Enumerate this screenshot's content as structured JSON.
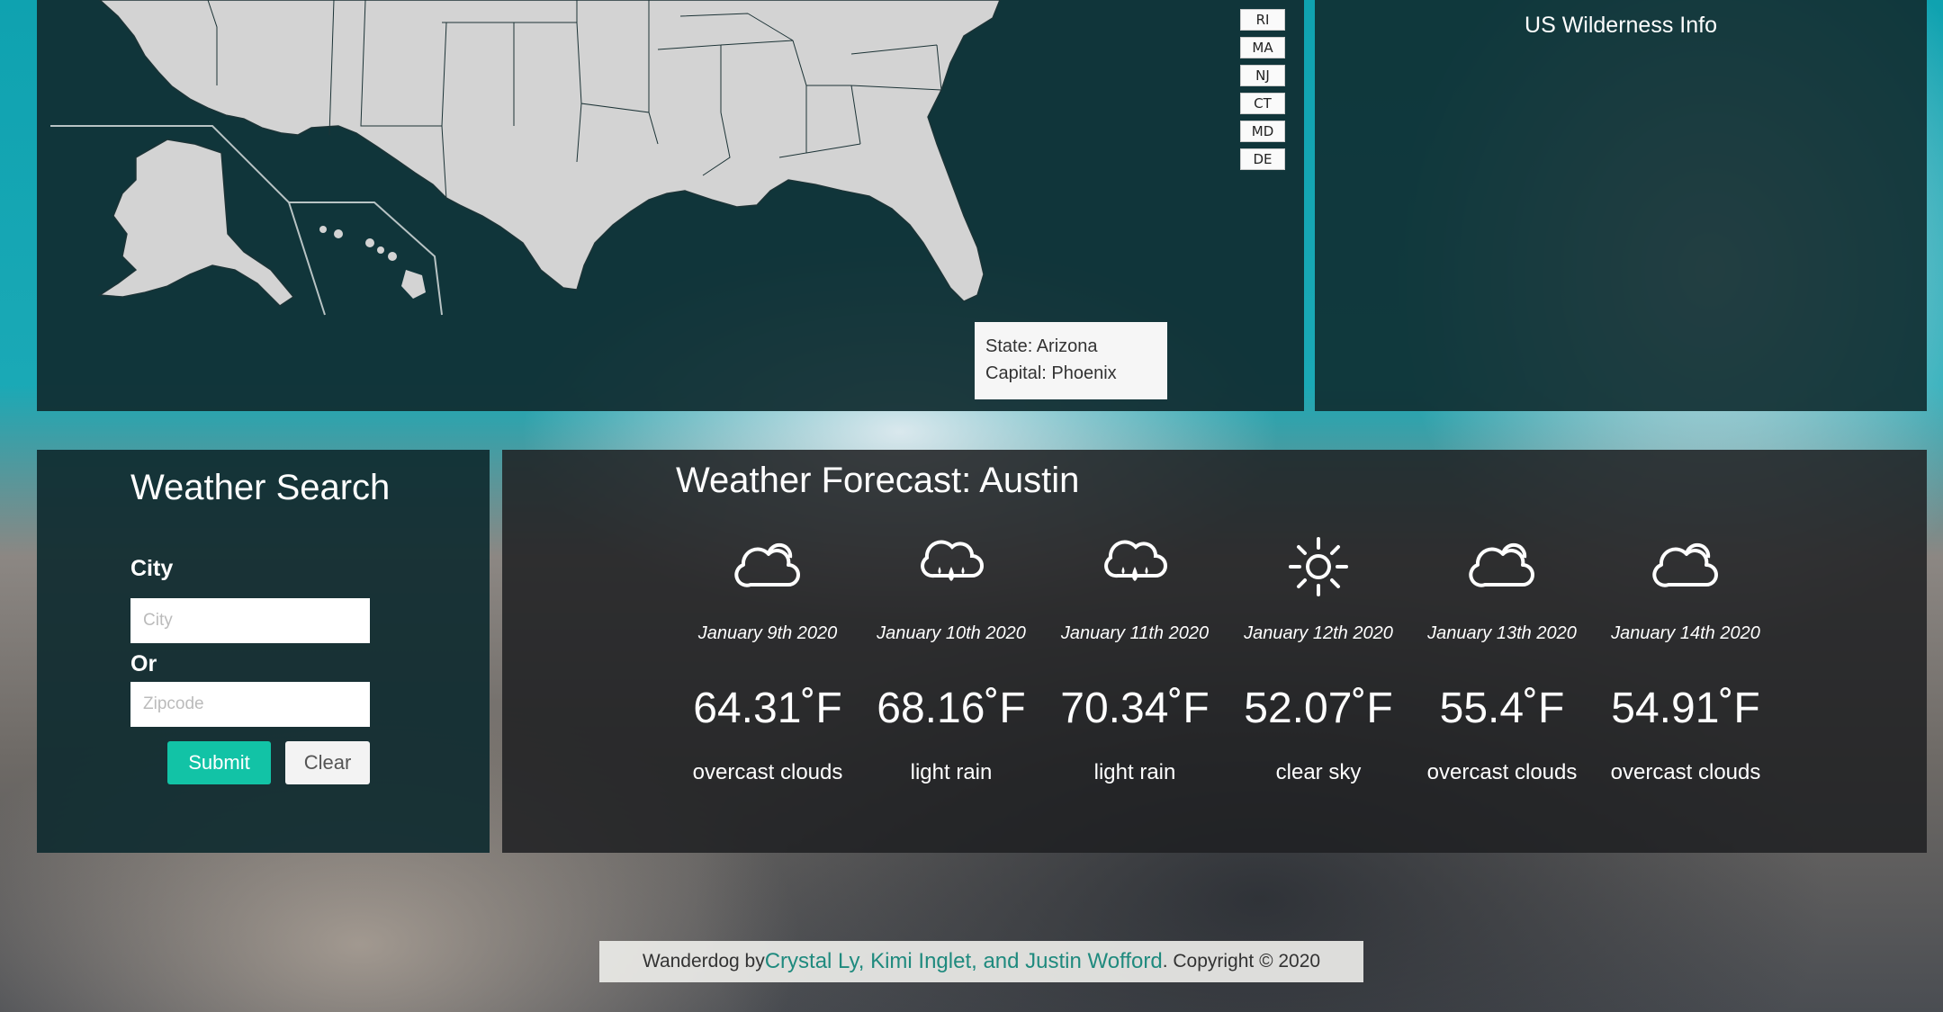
{
  "map": {
    "state_buttons": [
      "RI",
      "MA",
      "NJ",
      "CT",
      "MD",
      "DE"
    ],
    "tooltip": {
      "state_line": "State: Arizona",
      "capital_line": "Capital: Phoenix"
    }
  },
  "wilderness": {
    "title": "US Wilderness Info"
  },
  "search": {
    "title": "Weather Search",
    "city_label": "City",
    "city_placeholder": "City",
    "or_label": "Or",
    "zip_placeholder": "Zipcode",
    "submit_label": "Submit",
    "clear_label": "Clear",
    "submit_color": "#12c3a6"
  },
  "forecast": {
    "title": "Weather Forecast: Austin",
    "days": [
      {
        "date": "January 9th 2020",
        "temp": "64.31˚F",
        "desc": "overcast clouds",
        "icon": "cloud-icon"
      },
      {
        "date": "January 10th 2020",
        "temp": "68.16˚F",
        "desc": "light rain",
        "icon": "rain-cloud-icon"
      },
      {
        "date": "January 11th 2020",
        "temp": "70.34˚F",
        "desc": "light rain",
        "icon": "rain-cloud-icon"
      },
      {
        "date": "January 12th 2020",
        "temp": "52.07˚F",
        "desc": "clear sky",
        "icon": "sun-icon"
      },
      {
        "date": "January 13th 2020",
        "temp": "55.4˚F",
        "desc": "overcast clouds",
        "icon": "cloud-icon"
      },
      {
        "date": "January 14th 2020",
        "temp": "54.91˚F",
        "desc": "overcast clouds",
        "icon": "cloud-icon"
      }
    ]
  },
  "footer": {
    "prefix": "Wanderdog by ",
    "authors": "Crystal Ly, Kimi Inglet, and Justin Wofford",
    "suffix": ". Copyright © 2020",
    "link_color": "#1f8a7e"
  }
}
